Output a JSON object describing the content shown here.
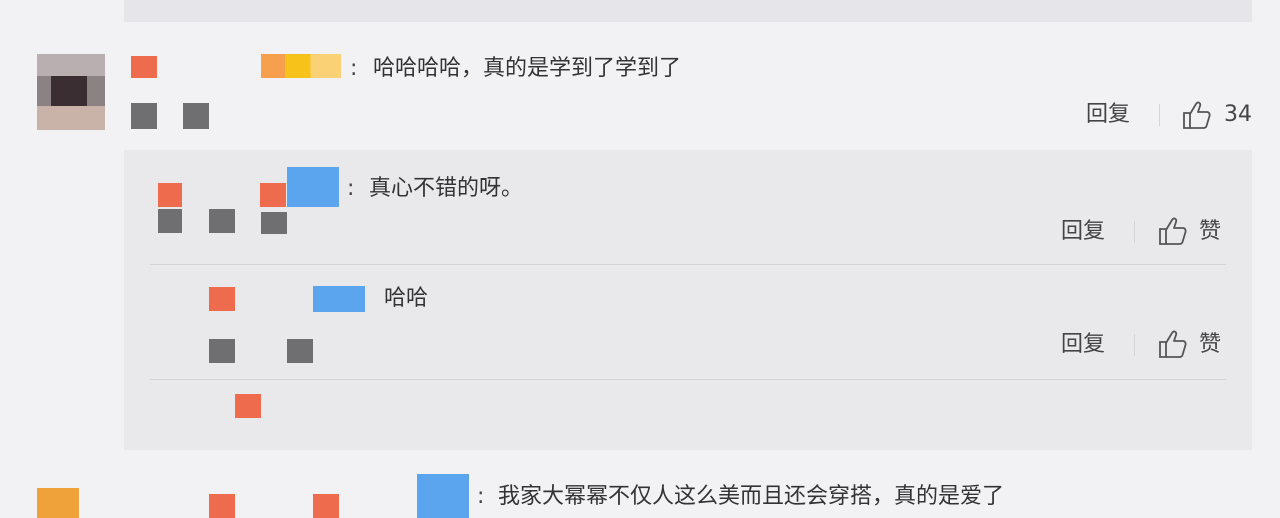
{
  "comments": [
    {
      "text": "哈哈哈哈，真的是学到了学到了",
      "colon": ":",
      "reply_label": "回复",
      "like_count": "34",
      "replies": [
        {
          "colon": ":",
          "text": "真心不错的呀。",
          "reply_label": "回复",
          "like_label": "赞"
        },
        {
          "text": "哈哈",
          "reply_label": "回复",
          "like_label": "赞"
        }
      ]
    },
    {
      "colon": ":",
      "text": "我家大幂幂不仅人这么美而且还会穿搭，真的是爱了"
    }
  ],
  "colors": {
    "accent_orange": "#ef6b4d",
    "accent_blue": "#5aa5ee",
    "panel_bg": "#e9e9ec"
  },
  "icons": [
    "thumbs-up-icon"
  ]
}
